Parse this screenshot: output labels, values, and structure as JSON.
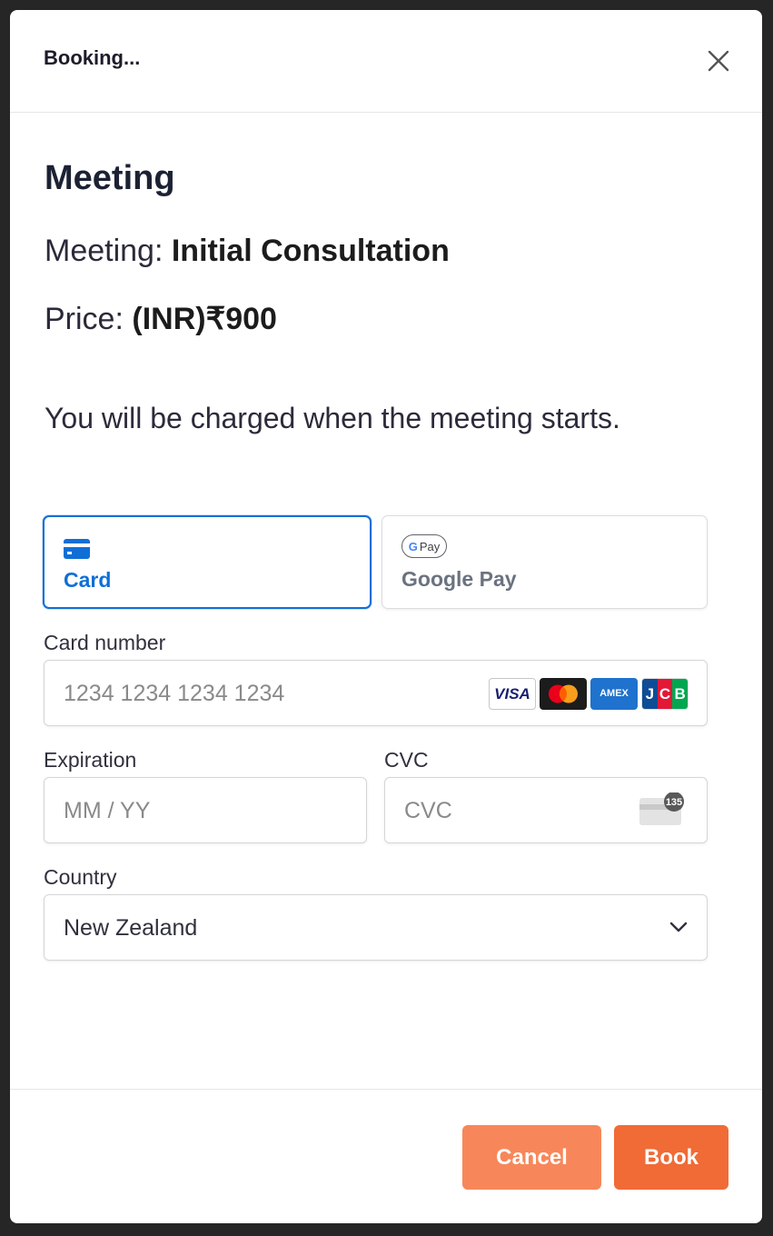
{
  "header": {
    "title": "Booking...",
    "close_icon": "close-icon"
  },
  "section": {
    "title": "Meeting"
  },
  "meeting": {
    "label": "Meeting:",
    "value": "Initial Consultation"
  },
  "price": {
    "label": "Price:",
    "currency": "(INR)",
    "amount": "₹900"
  },
  "charge_note": "You will be charged when the meeting starts.",
  "payment_methods": [
    {
      "label": "Card",
      "icon": "credit-card-icon",
      "selected": true
    },
    {
      "label": "Google Pay",
      "icon": "google-pay-icon",
      "badge": "Pay",
      "selected": false
    }
  ],
  "card_number": {
    "label": "Card number",
    "placeholder": "1234 1234 1234 1234",
    "brands": [
      "VISA",
      "Mastercard",
      "AMEX",
      "JCB"
    ]
  },
  "expiration": {
    "label": "Expiration",
    "placeholder": "MM / YY"
  },
  "cvc": {
    "label": "CVC",
    "placeholder": "CVC",
    "icon_badge": "135"
  },
  "country": {
    "label": "Country",
    "value": "New Zealand"
  },
  "footer": {
    "cancel_label": "Cancel",
    "book_label": "Book"
  },
  "colors": {
    "primary_blue": "#0f6fd6",
    "book_orange": "#f06b36",
    "cancel_orange": "#f7875a"
  }
}
